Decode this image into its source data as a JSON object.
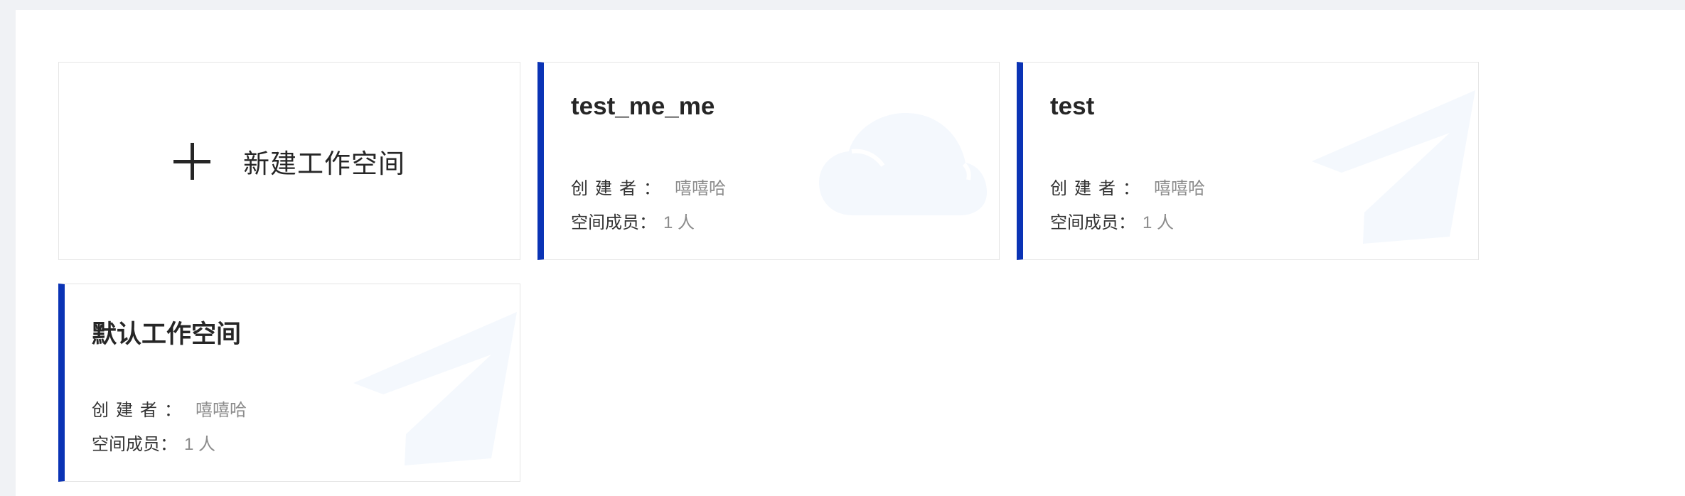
{
  "new_workspace": {
    "label": "新建工作空间"
  },
  "workspaces": [
    {
      "title": "test_me_me",
      "creator_label": "创建者：",
      "creator_value": "嘻嘻哈",
      "members_label": "空间成员：",
      "members_value": "1 人",
      "watermark_icon": "cloud-icon"
    },
    {
      "title": "test",
      "creator_label": "创建者：",
      "creator_value": "嘻嘻哈",
      "members_label": "空间成员：",
      "members_value": "1 人",
      "watermark_icon": "paper-plane-icon"
    },
    {
      "title": "默认工作空间",
      "creator_label": "创建者：",
      "creator_value": "嘻嘻哈",
      "members_label": "空间成员：",
      "members_value": "1 人",
      "watermark_icon": "paper-plane-icon"
    }
  ],
  "colors": {
    "accent": "#0a33b5",
    "page_background": "#f0f2f5",
    "watermark": "#f4f8fd"
  }
}
